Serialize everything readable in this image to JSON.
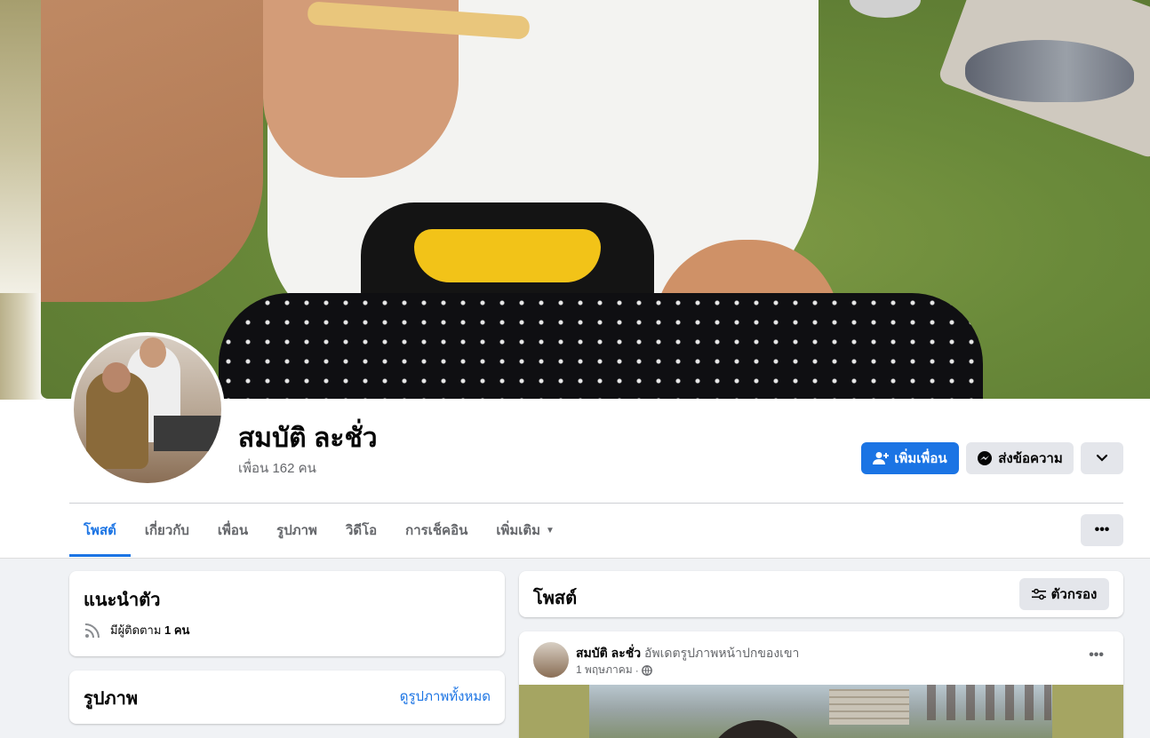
{
  "profile": {
    "name": "สมบัติ ละชั่ว",
    "friend_count": "เพื่อน 162 คน"
  },
  "actions": {
    "add_friend": "เพิ่มเพื่อน",
    "message": "ส่งข้อความ"
  },
  "tabs": [
    {
      "label": "โพสต์",
      "active": true
    },
    {
      "label": "เกี่ยวกับ"
    },
    {
      "label": "เพื่อน"
    },
    {
      "label": "รูปภาพ"
    },
    {
      "label": "วิดีโอ"
    },
    {
      "label": "การเช็คอิน"
    },
    {
      "label": "เพิ่มเติม"
    }
  ],
  "intro": {
    "title": "แนะนำตัว",
    "followers_prefix": "มีผู้ติดตาม",
    "followers_count": "1 คน"
  },
  "photos": {
    "title": "รูปภาพ",
    "see_all": "ดูรูปภาพทั้งหมด"
  },
  "posts": {
    "title": "โพสต์",
    "filter_label": "ตัวกรอง"
  },
  "post": {
    "author": "สมบัติ ละชั่ว",
    "action": "อัพเดตรูปภาพหน้าปกของเขา",
    "date": "1 พฤษภาคม",
    "separator": "·"
  },
  "colors": {
    "accent": "#1b74e4",
    "secondary_button": "#e4e6eb",
    "muted_text": "#65676b",
    "page_bg": "#f0f2f5"
  },
  "icons": {
    "add_friend": "person-plus-icon",
    "message": "messenger-icon",
    "dropdown": "chevron-down-icon",
    "more": "ellipsis-icon",
    "followers": "rss-icon",
    "filter": "sliders-icon",
    "privacy": "globe-icon"
  }
}
